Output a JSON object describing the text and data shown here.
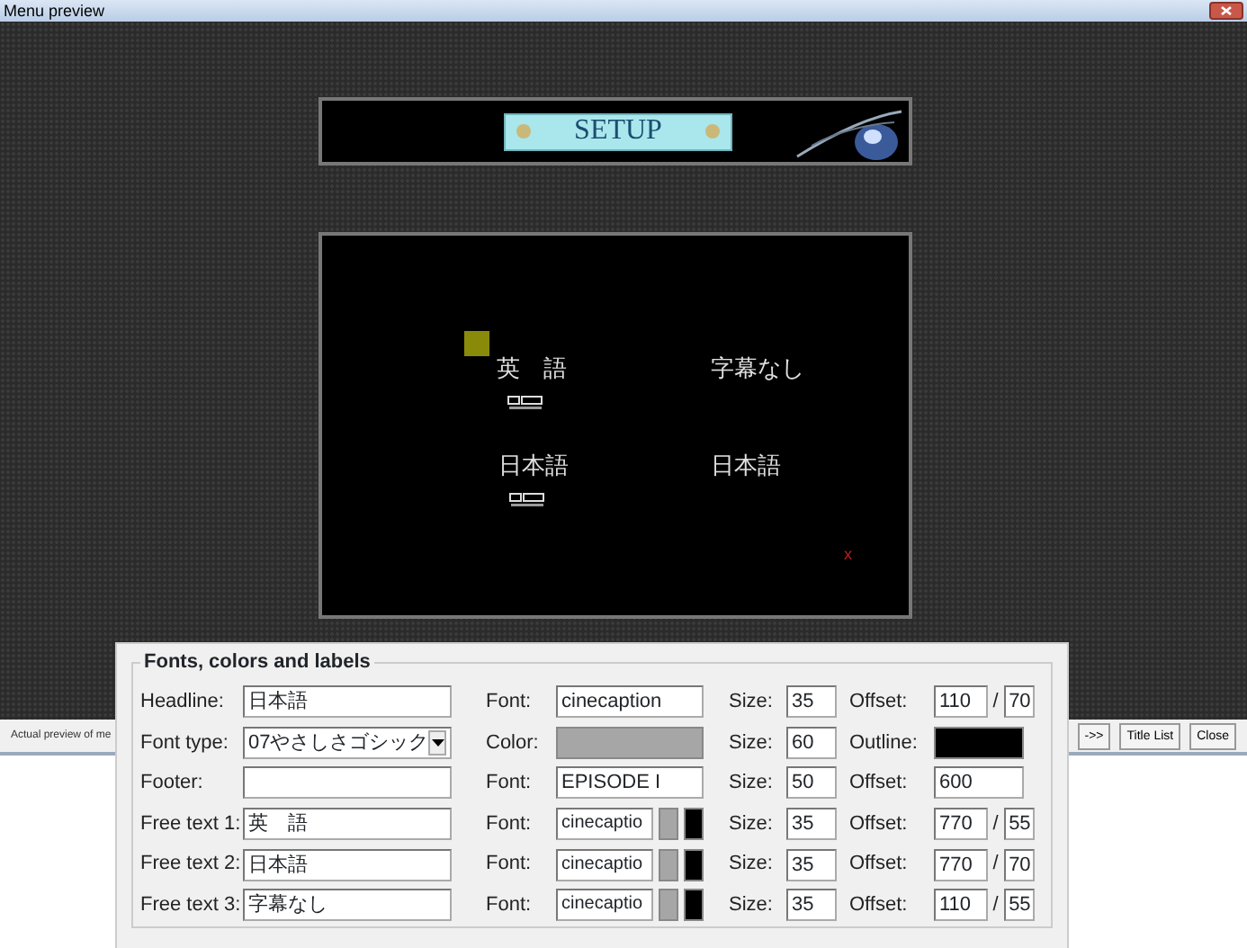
{
  "window": {
    "title": "Menu preview"
  },
  "preview": {
    "header_button": "SETUP",
    "items": [
      {
        "label": "英　語",
        "kind": "audio",
        "selected": true
      },
      {
        "label": "字幕なし",
        "kind": "subtitle",
        "selected": false
      },
      {
        "label": "日本語",
        "kind": "audio",
        "selected": false
      },
      {
        "label": "日本語",
        "kind": "subtitle",
        "selected": false
      }
    ],
    "marker": "x"
  },
  "status_bar": {
    "text": "Actual preview of me",
    "buttons": [
      "->>",
      "Title List",
      "Close"
    ]
  },
  "settings": {
    "title": "Fonts, colors and labels",
    "rows": [
      {
        "label": "Headline:",
        "kind": "text",
        "value": "日本語",
        "mid": {
          "label": "Font:",
          "kind": "font",
          "value": "cinecaption"
        },
        "size_label": "Size:",
        "size": "35",
        "end": {
          "label": "Offset:",
          "kind": "pair",
          "values": [
            "110",
            "70"
          ],
          "separator": "/"
        }
      },
      {
        "label": "Font type:",
        "kind": "select",
        "value": "07やさしさゴシック",
        "mid": {
          "label": "Color:",
          "kind": "color",
          "color": "#a6a6a6"
        },
        "size_label": "Size:",
        "size": "60",
        "end": {
          "label": "Outline:",
          "kind": "color",
          "color": "#000000"
        }
      },
      {
        "label": "Footer:",
        "kind": "text",
        "value": "",
        "mid": {
          "label": "Font:",
          "kind": "font",
          "value": "EPISODE I"
        },
        "size_label": "Size:",
        "size": "50",
        "end": {
          "label": "Offset:",
          "kind": "single",
          "values": [
            "600"
          ]
        }
      },
      {
        "label": "Free text 1:",
        "kind": "text",
        "value": "英　語",
        "mid": {
          "label": "Font:",
          "kind": "font_swatches",
          "value": "cinecaptio",
          "swatches": [
            {
              "color": "#a6a6a6"
            },
            {
              "color": "#000000"
            }
          ]
        },
        "size_label": "Size:",
        "size": "35",
        "end": {
          "label": "Offset:",
          "kind": "pair",
          "values": [
            "770",
            "55"
          ],
          "separator": "/"
        }
      },
      {
        "label": "Free text 2:",
        "kind": "text",
        "value": "日本語",
        "mid": {
          "label": "Font:",
          "kind": "font_swatches",
          "value": "cinecaptio",
          "swatches": [
            {
              "color": "#a6a6a6"
            },
            {
              "color": "#000000"
            }
          ]
        },
        "size_label": "Size:",
        "size": "35",
        "end": {
          "label": "Offset:",
          "kind": "pair",
          "values": [
            "770",
            "70"
          ],
          "separator": "/"
        }
      },
      {
        "label": "Free text 3:",
        "kind": "text",
        "value": "字幕なし",
        "mid": {
          "label": "Font:",
          "kind": "font_swatches",
          "value": "cinecaptio",
          "swatches": [
            {
              "color": "#a6a6a6"
            },
            {
              "color": "#000000"
            }
          ]
        },
        "size_label": "Size:",
        "size": "35",
        "end": {
          "label": "Offset:",
          "kind": "pair",
          "values": [
            "110",
            "55"
          ],
          "separator": "/"
        }
      }
    ]
  }
}
